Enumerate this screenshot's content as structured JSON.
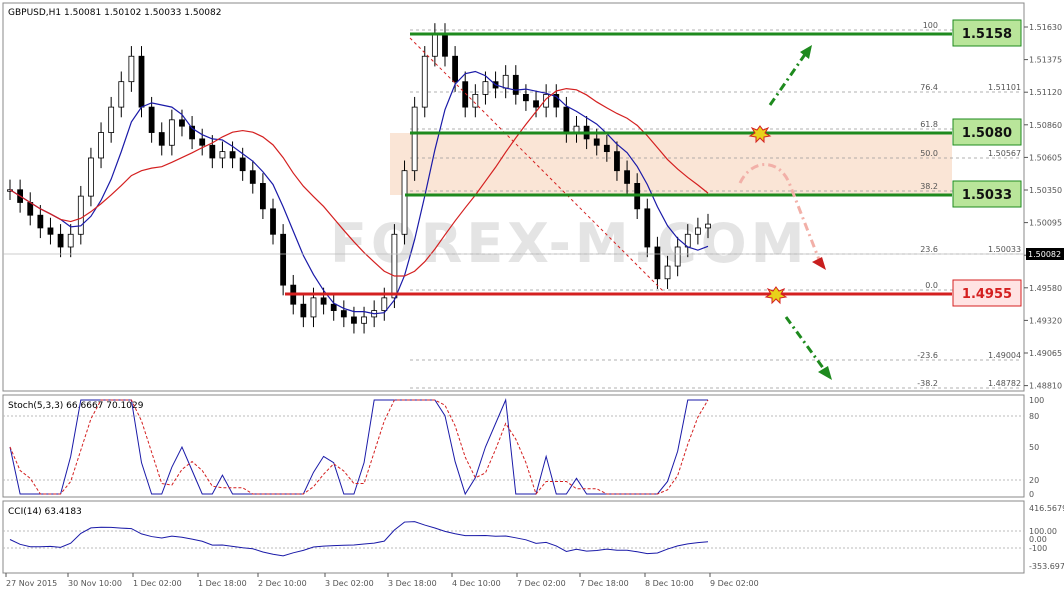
{
  "window": {
    "symbol_info": "GBPUSD,H1  1.50081 1.50102 1.50033 1.50082",
    "current_price": "1.50082",
    "watermark": "FOREX-M.COM"
  },
  "price_axis": {
    "ticks": [
      "1.51630",
      "1.51375",
      "1.51120",
      "1.50860",
      "1.50605",
      "1.50350",
      "1.50095",
      "1.49835",
      "1.49580",
      "1.49320",
      "1.49065",
      "1.48810"
    ]
  },
  "levels": {
    "green_top": "1.5158",
    "green_mid": "1.5080",
    "green_low": "1.5033",
    "red": "1.4955"
  },
  "fib": [
    {
      "label": "100",
      "value": ""
    },
    {
      "label": "76.4",
      "value": "1.51101"
    },
    {
      "label": "61.8",
      "value": ""
    },
    {
      "label": "50.0",
      "value": "1.50567"
    },
    {
      "label": "38.2",
      "value": ""
    },
    {
      "label": "23.6",
      "value": "1.50033"
    },
    {
      "label": "0.0",
      "value": ""
    },
    {
      "label": "-23.6",
      "value": "1.49004"
    },
    {
      "label": "-38.2",
      "value": "1.48782"
    }
  ],
  "stoch": {
    "title": "Stoch(5,3,3) 66.6667 70.1029",
    "ticks": [
      "100",
      "80",
      "50",
      "20",
      "0"
    ]
  },
  "cci": {
    "title": "CCI(14) 63.4183",
    "ticks": [
      "416.5679",
      "100.00",
      "0.00",
      "-100",
      "-353.697"
    ]
  },
  "time_axis": [
    "27 Nov 2015",
    "30 Nov 10:00",
    "1 Dec 02:00",
    "1 Dec 18:00",
    "2 Dec 10:00",
    "3 Dec 02:00",
    "3 Dec 18:00",
    "4 Dec 10:00",
    "7 Dec 02:00",
    "7 Dec 18:00",
    "8 Dec 10:00",
    "9 Dec 02:00"
  ],
  "colors": {
    "bull": "#000000",
    "bear": "#000000",
    "ma_fast": "#1a1aa8",
    "ma_slow": "#d42020",
    "green": "#1e8a1e",
    "red": "#d42020",
    "zone": "#f8dcc8"
  },
  "chart_data": {
    "type": "candlestick",
    "title": "GBPUSD,H1",
    "closes": [
      1.5035,
      1.5025,
      1.5015,
      1.5005,
      1.5,
      1.499,
      1.5,
      1.503,
      1.506,
      1.508,
      1.51,
      1.512,
      1.514,
      1.51,
      1.508,
      1.507,
      1.509,
      1.5085,
      1.5075,
      1.507,
      1.506,
      1.5065,
      1.506,
      1.505,
      1.504,
      1.502,
      1.5,
      1.496,
      1.4945,
      1.4935,
      1.495,
      1.4945,
      1.494,
      1.4935,
      1.493,
      1.4935,
      1.494,
      1.495,
      1.5,
      1.505,
      1.51,
      1.514,
      1.5158,
      1.514,
      1.512,
      1.51,
      1.511,
      1.512,
      1.5115,
      1.5125,
      1.511,
      1.5105,
      1.51,
      1.511,
      1.51,
      1.508,
      1.5085,
      1.5075,
      1.507,
      1.5065,
      1.505,
      1.504,
      1.502,
      1.499,
      1.4965,
      1.4975,
      1.499,
      1.5,
      1.5005,
      1.5008
    ],
    "ylim": [
      1.4881,
      1.5163
    ]
  }
}
